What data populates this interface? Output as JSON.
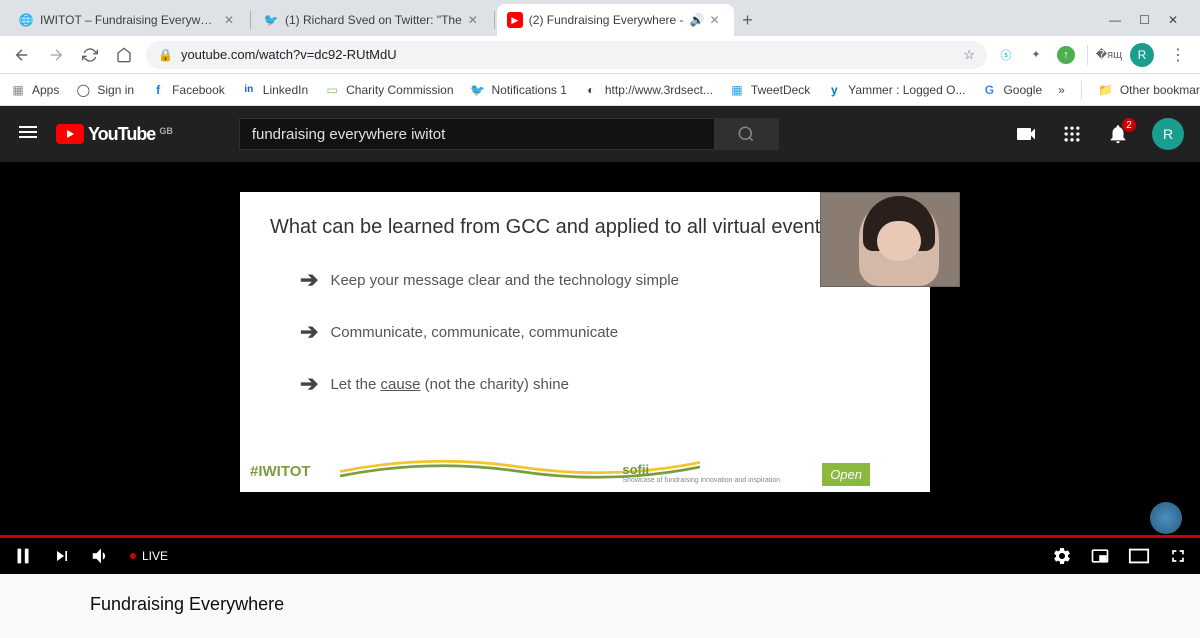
{
  "window": {
    "min": "—",
    "max": "☐",
    "close": "✕"
  },
  "tabs": [
    {
      "title": "IWITOT – Fundraising Everywhere",
      "active": false
    },
    {
      "title": "(1) Richard Sved on Twitter: \"The",
      "active": false
    },
    {
      "title": "(2) Fundraising Everywhere -",
      "active": true,
      "audio": true
    }
  ],
  "addr": {
    "url": "youtube.com/watch?v=dc92-RUtMdU"
  },
  "bookmarks": [
    {
      "label": "Apps",
      "icon": "⋮⋮⋮"
    },
    {
      "label": "Sign in",
      "icon": "◯"
    },
    {
      "label": "Facebook",
      "icon": "f"
    },
    {
      "label": "LinkedIn",
      "icon": "in"
    },
    {
      "label": "Charity Commission",
      "icon": "▭"
    },
    {
      "label": "Notifications 1",
      "icon": "🐦"
    },
    {
      "label": "http://www.3rdsect...",
      "icon": "◐"
    },
    {
      "label": "TweetDeck",
      "icon": "▦"
    },
    {
      "label": "Yammer : Logged O...",
      "icon": "y"
    },
    {
      "label": "Google",
      "icon": "G"
    }
  ],
  "bookmarks_other": {
    "chevron": "»",
    "label": "Other bookmarks"
  },
  "yt": {
    "logo_text": "YouTube",
    "region": "GB",
    "search_value": "fundraising everywhere iwitot",
    "notif_count": "2",
    "avatar": "R"
  },
  "slide": {
    "heading": "What can be learned from GCC and applied to all virtual events?",
    "bullets": [
      "Keep your message clear and the technology simple",
      "Communicate, communicate, communicate"
    ],
    "bullet3_pre": "Let the ",
    "bullet3_u": "cause",
    "bullet3_post": " (not the charity) shine",
    "hashtag": "#IWITOT",
    "sofii": "sofii",
    "sofii_tag": "Showcase of fundraising innovation and inspiration",
    "open": "Open"
  },
  "player": {
    "live": "LIVE"
  },
  "below": {
    "title": "Fundraising Everywhere"
  },
  "profile": {
    "letter": "R"
  }
}
